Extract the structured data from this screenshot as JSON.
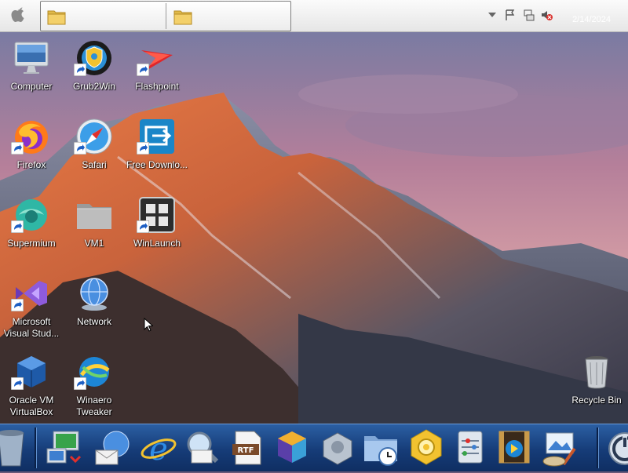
{
  "menubar": {
    "tasks": [
      {
        "label": "",
        "icon": "folder-icon"
      },
      {
        "label": "",
        "icon": "folder-icon"
      }
    ],
    "clock": "2/14/2024"
  },
  "desktop": {
    "icons": [
      {
        "label": "Computer",
        "icon": "imac-icon"
      },
      {
        "label": "Grub2Win",
        "icon": "grub2win-icon"
      },
      {
        "label": "Flashpoint",
        "icon": "flashpoint-icon"
      },
      {
        "label": "Firefox",
        "icon": "firefox-icon"
      },
      {
        "label": "Safari",
        "icon": "safari-icon"
      },
      {
        "label": "Free Downlo...",
        "icon": "free-download-icon"
      },
      {
        "label": "Supermium",
        "icon": "supermium-icon"
      },
      {
        "label": "VM1",
        "icon": "folder-icon"
      },
      {
        "label": "WinLaunch",
        "icon": "winlaunch-icon"
      },
      {
        "label": "Microsoft Visual Stud...",
        "icon": "visual-studio-icon"
      },
      {
        "label": "Network",
        "icon": "network-globe-icon"
      },
      {
        "label": "Oracle VM VirtualBox",
        "icon": "virtualbox-icon"
      },
      {
        "label": "Winaero Tweaker",
        "icon": "winaero-icon"
      },
      {
        "label": "Recycle Bin",
        "icon": "recycle-bin-icon"
      }
    ]
  },
  "dock": {
    "items": [
      "trash-icon",
      "computer-network-icon",
      "mail-icon",
      "internet-explorer-icon",
      "search-icon",
      "rtf-document-icon",
      "cube-icon",
      "hard-drive-icon",
      "folder-clock-icon",
      "gear-icon",
      "settings-icon",
      "media-player-icon",
      "paint-icon",
      "power-icon"
    ]
  },
  "colors": {
    "sky": "#7c7a9c",
    "peak": "#e0693a",
    "dock": "#1d4a8a"
  }
}
